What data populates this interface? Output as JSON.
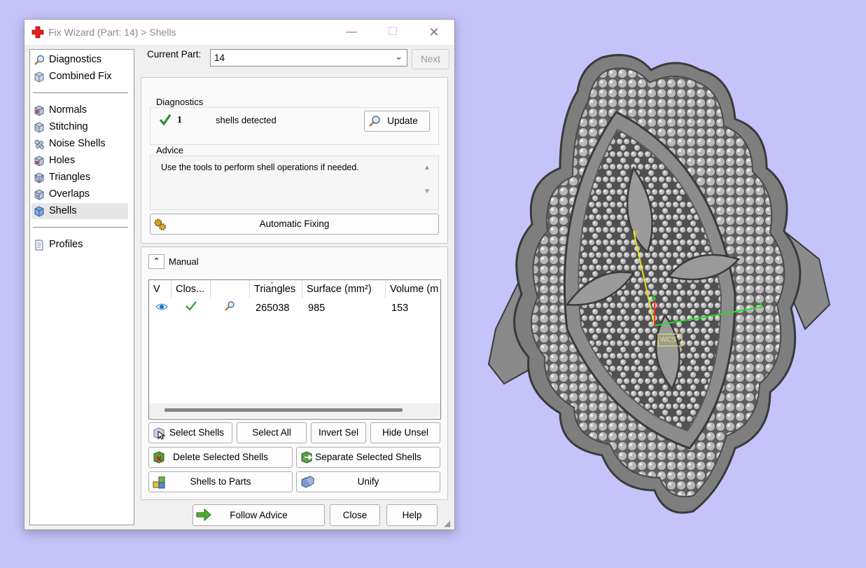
{
  "window": {
    "title": "Fix Wizard (Part: 14) > Shells",
    "minimize": "—",
    "maximize": "☐",
    "close": "✕"
  },
  "nav": {
    "items": [
      {
        "label": "Diagnostics",
        "icon": "magnifier-icon"
      },
      {
        "label": "Combined Fix",
        "icon": "cube-icon"
      },
      {
        "label": "Normals",
        "icon": "cube-normals-icon"
      },
      {
        "label": "Stitching",
        "icon": "cube-stitching-icon"
      },
      {
        "label": "Noise Shells",
        "icon": "noise-shells-icon"
      },
      {
        "label": "Holes",
        "icon": "cube-holes-icon"
      },
      {
        "label": "Triangles",
        "icon": "cube-triangles-icon"
      },
      {
        "label": "Overlaps",
        "icon": "cube-overlaps-icon"
      },
      {
        "label": "Shells",
        "icon": "cube-shells-icon",
        "selected": true
      },
      {
        "label": "Profiles",
        "icon": "document-icon"
      }
    ]
  },
  "current_part": {
    "label": "Current Part:",
    "value": "14",
    "next_label": "Next"
  },
  "diagnostics": {
    "group_label": "Diagnostics",
    "count": "1",
    "text": "shells detected",
    "update_label": "Update"
  },
  "advice": {
    "group_label": "Advice",
    "text": "Use the tools to perform shell operations if needed."
  },
  "automatic_fixing_label": "Automatic Fixing",
  "manual": {
    "label": "Manual",
    "columns": [
      "V",
      "Clos...",
      "",
      "Triangles",
      "Surface (mm²)",
      "Volume (m"
    ],
    "rows": [
      {
        "triangles": "265038",
        "surface": "985",
        "volume": "153"
      }
    ]
  },
  "buttons": {
    "select_shells": "Select Shells",
    "select_all": "Select All",
    "invert_sel": "Invert Sel",
    "hide_unsel": "Hide Unsel",
    "delete_selected": "Delete Selected Shells",
    "separate_selected": "Separate Selected Shells",
    "shells_to_parts": "Shells to Parts",
    "unify": "Unify",
    "follow_advice": "Follow Advice",
    "close": "Close",
    "help": "Help"
  },
  "viewport": {
    "background": "#c4c4fa",
    "axis_x": "x",
    "axis_y": "y",
    "axis_z": "z",
    "view_label": "WCS"
  }
}
